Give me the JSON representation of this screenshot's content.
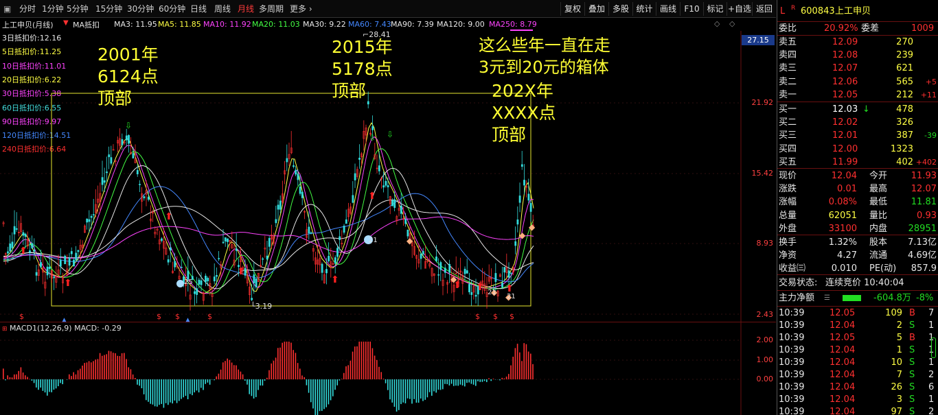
{
  "toolbar": {
    "periods": [
      "分时",
      "1分钟",
      "5分钟",
      "15分钟",
      "30分钟",
      "60分钟",
      "日线",
      "周线",
      "月线",
      "多周期",
      "更多 ›"
    ],
    "active_period": "月线",
    "right_buttons": [
      "复权",
      "叠加",
      "多股",
      "统计",
      "画线",
      "F10",
      "标记",
      "+自选",
      "返回"
    ]
  },
  "ma_line": {
    "title": "上工申贝(月线)",
    "indicator": "MA抵扣",
    "items": [
      {
        "label": "MA3: 11.95",
        "color": "#e8e8e8"
      },
      {
        "label": "MA5: 11.85",
        "color": "#ffff44"
      },
      {
        "label": "MA10: 11.92",
        "color": "#ff44ff"
      },
      {
        "label": "MA20: 11.03",
        "color": "#44ff44"
      },
      {
        "label": "MA30: 9.22",
        "color": "#e8e8e8"
      },
      {
        "label": "MA60: 7.43",
        "color": "#4488ff"
      },
      {
        "label": "MA90: 7.39",
        "color": "#e8e8e8"
      },
      {
        "label": "MA120: 9.00",
        "color": "#e8e8e8"
      },
      {
        "label": "MA250: 8.79",
        "color": "#ff44ff"
      }
    ]
  },
  "legend": [
    {
      "label": "3日抵扣价:12.16",
      "color": "#e8e8e8"
    },
    {
      "label": "5日抵扣价:11.25",
      "color": "#ffff44"
    },
    {
      "label": "10日抵扣价:11.01",
      "color": "#ff44ff"
    },
    {
      "label": "20日抵扣价:6.22",
      "color": "#ffff44"
    },
    {
      "label": "30日抵扣价:5.38",
      "color": "#ff44ff"
    },
    {
      "label": "60日抵扣价:6.55",
      "color": "#44dddd"
    },
    {
      "label": "90日抵扣价:9.97",
      "color": "#ff44ff"
    },
    {
      "label": "120日抵扣价:14.51",
      "color": "#4488ff"
    },
    {
      "label": "240日抵扣价:6.64",
      "color": "#ff3030"
    }
  ],
  "annotations": {
    "a2001": [
      "2001年",
      "6124点",
      "顶部"
    ],
    "a2015": [
      "2015年",
      "5178点",
      "顶部"
    ],
    "a202x": [
      "202X年",
      "XXXX点",
      "顶部"
    ],
    "box_note": [
      "这么些年一直在走",
      "3元到20元的箱体"
    ]
  },
  "price_labels": {
    "high": "28.41",
    "low": "3.19",
    "current_tag": "27.15",
    "circle_21a": "21",
    "circle_21b": "21",
    "circle_21c": "21",
    "circle_25": "25"
  },
  "price_axis": [
    "21.92",
    "15.42",
    "8.93",
    "2.43"
  ],
  "macd": {
    "label": "MACD1(12,26,9)  MACD: -0.29",
    "axis": [
      "2.00",
      "1.00",
      "0.00"
    ]
  },
  "quote": {
    "code": "600843",
    "name": "上工申贝",
    "weibi_label": "委比",
    "weibi": "20.92%",
    "weicha_label": "委差",
    "weicha": "1009",
    "sell": [
      {
        "label": "卖五",
        "price": "12.09",
        "vol": "270",
        "chg": ""
      },
      {
        "label": "卖四",
        "price": "12.08",
        "vol": "239",
        "chg": ""
      },
      {
        "label": "卖三",
        "price": "12.07",
        "vol": "621",
        "chg": ""
      },
      {
        "label": "卖二",
        "price": "12.06",
        "vol": "565",
        "chg": "+5"
      },
      {
        "label": "卖一",
        "price": "12.05",
        "vol": "212",
        "chg": "+11"
      }
    ],
    "buy": [
      {
        "label": "买一",
        "price": "12.03",
        "vol": "478",
        "chg": ""
      },
      {
        "label": "买二",
        "price": "12.02",
        "vol": "326",
        "chg": ""
      },
      {
        "label": "买三",
        "price": "12.01",
        "vol": "387",
        "chg": "-39"
      },
      {
        "label": "买四",
        "price": "12.00",
        "vol": "1323",
        "chg": ""
      },
      {
        "label": "买五",
        "price": "11.99",
        "vol": "402",
        "chg": "+402"
      }
    ],
    "stats": [
      {
        "l1": "现价",
        "v1": "12.04",
        "c1": "red",
        "l2": "今开",
        "v2": "11.93",
        "c2": "red"
      },
      {
        "l1": "涨跌",
        "v1": "0.01",
        "c1": "red",
        "l2": "最高",
        "v2": "12.07",
        "c2": "red"
      },
      {
        "l1": "涨幅",
        "v1": "0.08%",
        "c1": "red",
        "l2": "最低",
        "v2": "11.81",
        "c2": "green"
      },
      {
        "l1": "总量",
        "v1": "62051",
        "c1": "yellow",
        "l2": "量比",
        "v2": "0.93",
        "c2": "red"
      },
      {
        "l1": "外盘",
        "v1": "33100",
        "c1": "red",
        "l2": "内盘",
        "v2": "28951",
        "c2": "green"
      }
    ],
    "fin": [
      {
        "l1": "换手",
        "v1": "1.32%",
        "l2": "股本",
        "v2": "7.13亿"
      },
      {
        "l1": "净资",
        "v1": "4.27",
        "l2": "流通",
        "v2": "4.69亿"
      },
      {
        "l1": "收益㈢",
        "v1": "0.010",
        "l2": "PE(动)",
        "v2": "857.9"
      }
    ],
    "trade_status_label": "交易状态:",
    "trade_status": "连续竞价 10:40:04",
    "net_label": "主力净额",
    "net_value": "-604.8万",
    "net_pct": "-8%",
    "ticks": [
      {
        "t": "10:39",
        "p": "12.05",
        "v": "109",
        "s": "B",
        "n": "7"
      },
      {
        "t": "10:39",
        "p": "12.04",
        "v": "2",
        "s": "S",
        "n": "1"
      },
      {
        "t": "10:39",
        "p": "12.05",
        "v": "5",
        "s": "B",
        "n": "1"
      },
      {
        "t": "10:39",
        "p": "12.04",
        "v": "1",
        "s": "S",
        "n": "1"
      },
      {
        "t": "10:39",
        "p": "12.04",
        "v": "10",
        "s": "S",
        "n": "1"
      },
      {
        "t": "10:39",
        "p": "12.04",
        "v": "7",
        "s": "S",
        "n": "2"
      },
      {
        "t": "10:39",
        "p": "12.04",
        "v": "26",
        "s": "S",
        "n": "6"
      },
      {
        "t": "10:39",
        "p": "12.04",
        "v": "3",
        "s": "S",
        "n": "1"
      },
      {
        "t": "10:39",
        "p": "12.04",
        "v": "97",
        "s": "S",
        "n": "2"
      }
    ]
  }
}
